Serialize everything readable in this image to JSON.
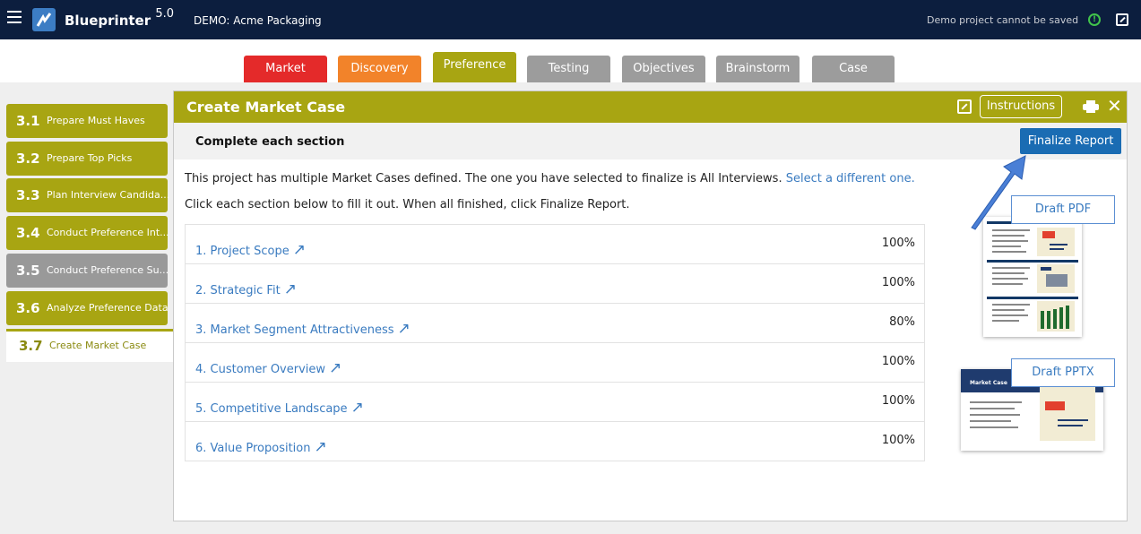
{
  "topbar": {
    "app_name": "Blueprinter",
    "version": "5.0",
    "project": "DEMO: Acme Packaging",
    "note": "Demo project cannot be saved",
    "alert_symbol": "!"
  },
  "tabs": [
    {
      "label": "Market",
      "color": "#e42a2a"
    },
    {
      "label": "Discovery",
      "color": "#f2832a"
    },
    {
      "label": "Preference",
      "color": "#a8a512"
    },
    {
      "label": "Testing",
      "color": "#9c9c9c"
    },
    {
      "label": "Objectives",
      "color": "#9c9c9c"
    },
    {
      "label": "Brainstorm",
      "color": "#9c9c9c"
    },
    {
      "label": "Case",
      "color": "#9c9c9c"
    }
  ],
  "sidebar": [
    {
      "num": "3.1",
      "label": "Prepare Must Haves",
      "color": "#a8a512"
    },
    {
      "num": "3.2",
      "label": "Prepare Top Picks",
      "color": "#a8a512"
    },
    {
      "num": "3.3",
      "label": "Plan Interview Candida...",
      "color": "#a8a512"
    },
    {
      "num": "3.4",
      "label": "Conduct Preference Int...",
      "color": "#a8a512"
    },
    {
      "num": "3.5",
      "label": "Conduct Preference Su...",
      "color": "#999999"
    },
    {
      "num": "3.6",
      "label": "Analyze Preference Data",
      "color": "#a8a512"
    },
    {
      "num": "3.7",
      "label": "Create Market Case",
      "color": "#ffffff"
    }
  ],
  "panel": {
    "title": "Create Market Case",
    "instructions_label": "Instructions",
    "close_symbol": "✕",
    "section_title": "Complete each section",
    "finalize_label": "Finalize Report",
    "intro_text": "This project has multiple Market Cases defined. The one you have selected to finalize is All Interviews.",
    "intro_link": "Select a different one.",
    "instruction_text": "Click each section below to fill it out. When all finished, click Finalize Report.",
    "sections": [
      {
        "label": "1. Project Scope",
        "pct": "100%"
      },
      {
        "label": "2. Strategic Fit",
        "pct": "100%"
      },
      {
        "label": "3. Market Segment Attractiveness",
        "pct": "80%"
      },
      {
        "label": "4. Customer Overview",
        "pct": "100%"
      },
      {
        "label": "5. Competitive Landscape",
        "pct": "100%"
      },
      {
        "label": "6. Value Proposition",
        "pct": "100%"
      }
    ],
    "arrow_symbol": "↗",
    "draft_pdf_label": "Draft PDF",
    "draft_pptx_label": "Draft PPTX",
    "pptx_thumb_title": "Market Case"
  }
}
